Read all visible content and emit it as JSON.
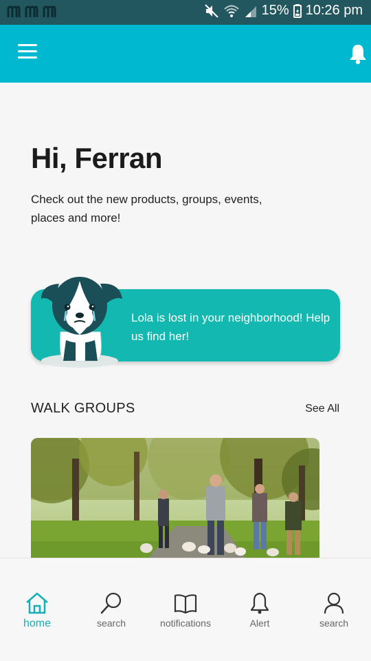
{
  "status": {
    "battery": "15%",
    "time": "10:26 pm"
  },
  "header": {
    "menu_icon": "hamburger-menu-icon",
    "bell_icon": "bell-icon"
  },
  "greeting": "Hi, Ferran",
  "subtitle": "Check out the new products, groups, events, places and more!",
  "lost_pet": {
    "message": "Lola is lost in your neighborhood! Help us find her!",
    "card_color": "#13b8b0"
  },
  "walk_groups": {
    "title": "WALK GROUPS",
    "see_all": "See All"
  },
  "nav": [
    {
      "label": "home",
      "icon": "home-icon",
      "active": true
    },
    {
      "label": "search",
      "icon": "search-icon",
      "active": false
    },
    {
      "label": "notifications",
      "icon": "book-icon",
      "active": false
    },
    {
      "label": "Alert",
      "icon": "bell-icon",
      "active": false
    },
    {
      "label": "search",
      "icon": "user-icon",
      "active": false
    }
  ],
  "colors": {
    "status_bar": "#23575f",
    "app_bar": "#00b9d1",
    "accent": "#14aeb6"
  }
}
